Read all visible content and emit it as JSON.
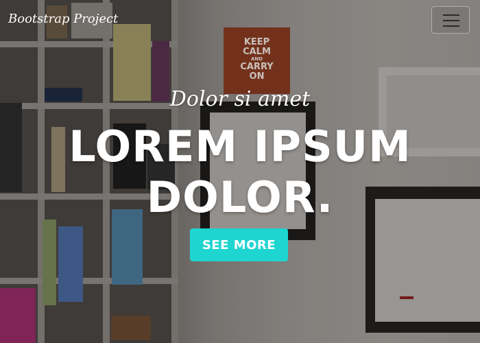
{
  "navbar": {
    "brand": "Bootstrap Project",
    "toggler_icon": "hamburger-menu-icon"
  },
  "poster": {
    "lines": [
      "KEEP",
      "CALM",
      "AND",
      "CARRY",
      "ON"
    ]
  },
  "hero": {
    "subtitle": "Dolor si amet",
    "headline_line1": "LOREM IPSUM",
    "headline_line2": "DOLOR.",
    "cta_label": "SEE MORE"
  },
  "colors": {
    "accent": "#1fd5d0",
    "text": "#ffffff"
  }
}
